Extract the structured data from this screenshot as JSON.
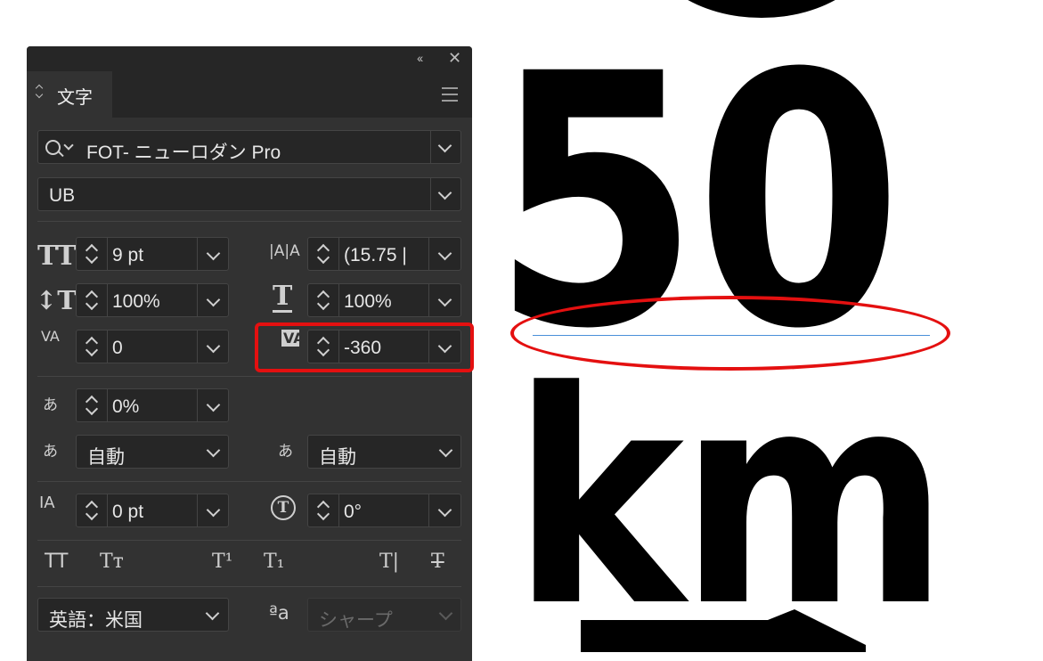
{
  "canvas": {
    "text_top": "50",
    "text_bottom": "km"
  },
  "panel": {
    "collapse_glyph": "‹‹",
    "close_glyph": "✕",
    "tab_arrows": "◇",
    "tab_title": "文字",
    "font_family": "FOT- ニューロダン Pro",
    "font_style": "UB",
    "font_size": "9 pt",
    "leading": "(15.75 |",
    "vertical_scale": "100%",
    "horizontal_scale": "100%",
    "kerning": "0",
    "tracking": "-360",
    "tsume": "0%",
    "aki_left": "自動",
    "aki_right": "自動",
    "baseline_shift": "0 pt",
    "rotation": "0°",
    "language": "英語：米国",
    "antialias": "シャープ",
    "aa_icon": "ªa"
  },
  "icons": {
    "font_size_icon": "TT",
    "leading_icon": "|A|A",
    "vscale_icon": "↕T",
    "hscale_icon": "T",
    "kerning_icon": "VA",
    "tracking_icon": "VA",
    "tsume_icon": "あ",
    "aki_left_icon": "あ",
    "aki_right_icon": "あ",
    "baseline_icon": "IA",
    "rotation_icon": "T",
    "allcaps_icon": "TT",
    "smallcaps_icon": "Tт",
    "superscript_icon": "T¹",
    "subscript_icon": "T₁",
    "underline_icon": "T|",
    "strike_icon": "T"
  },
  "colors": {
    "panel_bg": "#323232",
    "highlight": "#e41010",
    "baseline_guide": "#4a90d9"
  }
}
